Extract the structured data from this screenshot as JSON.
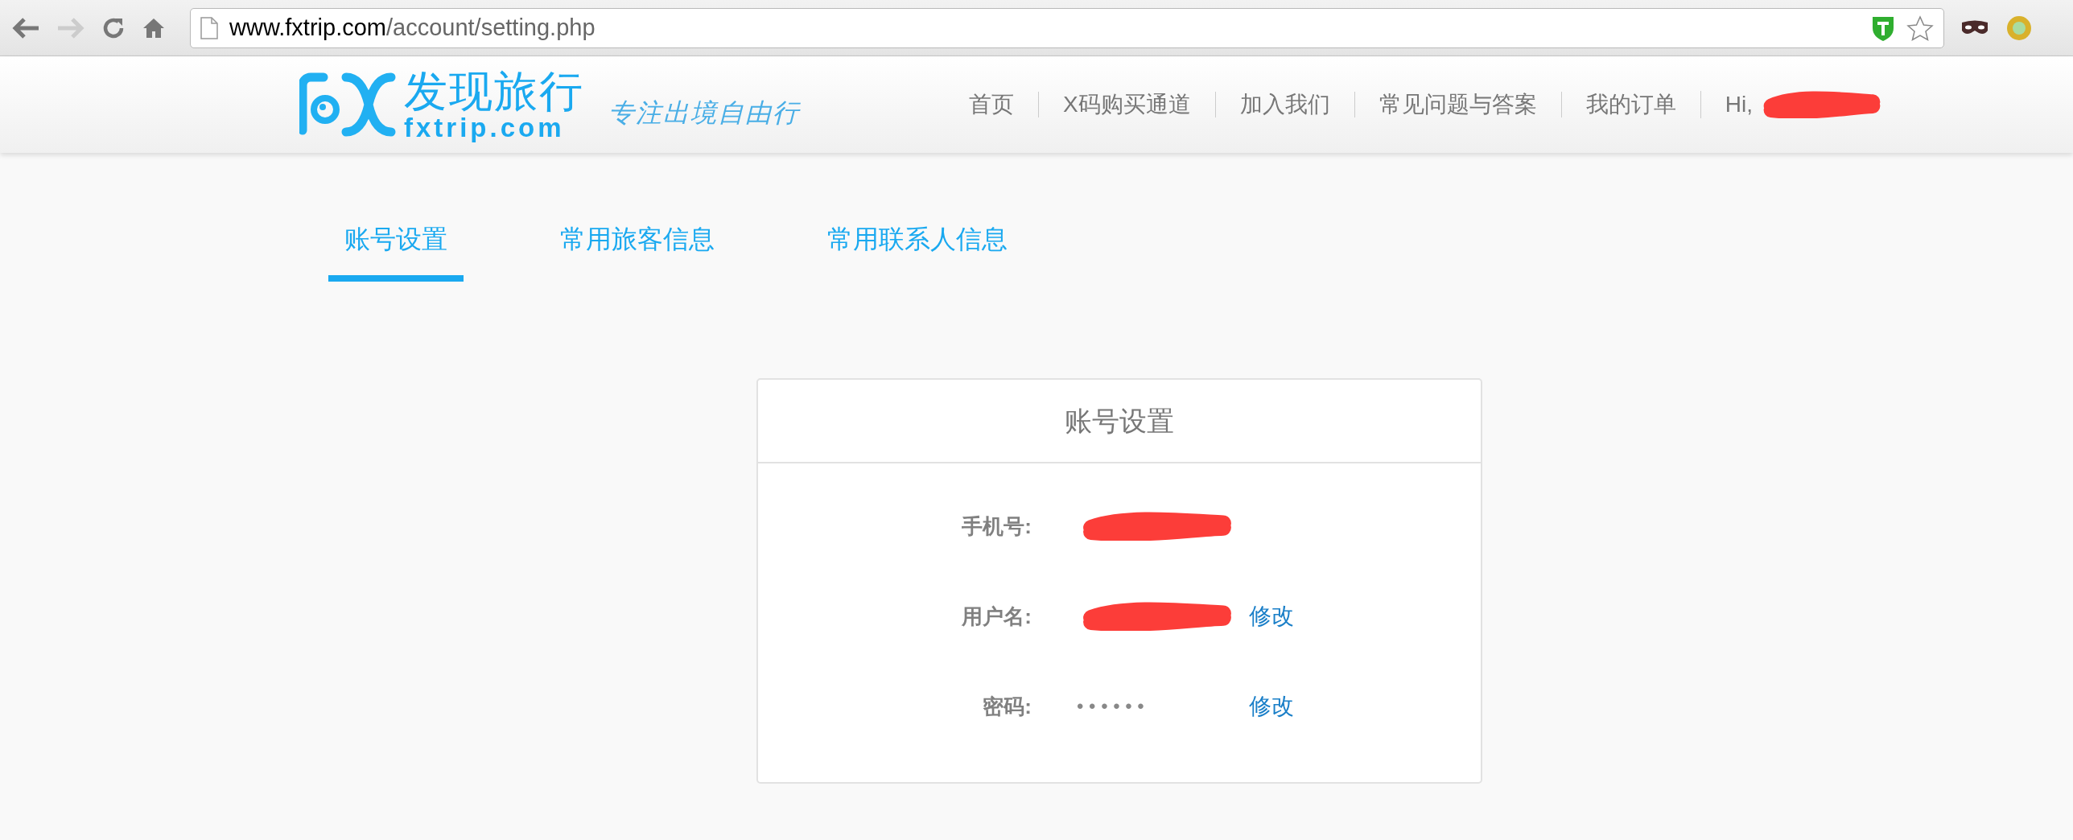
{
  "browser": {
    "url_host": "www.fxtrip.com",
    "url_path": "/account/setting.php"
  },
  "site": {
    "logo_name": "发现旅行",
    "logo_domain": "fxtrip.com",
    "tagline": "专注出境自由行"
  },
  "nav": [
    {
      "label": "首页"
    },
    {
      "label": "X码购买通道"
    },
    {
      "label": "加入我们"
    },
    {
      "label": "常见问题与答案"
    },
    {
      "label": "我的订单"
    }
  ],
  "greeting": {
    "label": "Hi,",
    "redacted": true
  },
  "tabs": [
    {
      "label": "账号设置",
      "selected": true
    },
    {
      "label": "常用旅客信息",
      "selected": false
    },
    {
      "label": "常用联系人信息",
      "selected": false
    }
  ],
  "card": {
    "title": "账号设置",
    "rows": [
      {
        "label": "手机号:",
        "redacted": true
      },
      {
        "label": "用户名:",
        "redacted": true,
        "action": "修改"
      },
      {
        "label": "密码:",
        "value": "• • • • • •",
        "redacted": false,
        "action": "修改"
      }
    ]
  }
}
